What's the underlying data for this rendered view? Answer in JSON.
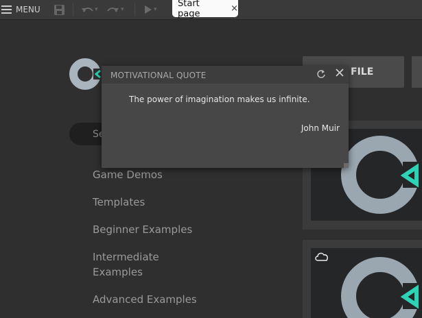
{
  "toolbar": {
    "menu_label": "MENU",
    "tab_label": "Start page",
    "tab_close": "×",
    "icons": [
      "menu-icon",
      "save-icon",
      "undo-icon",
      "redo-icon",
      "play-icon"
    ]
  },
  "search": {
    "placeholder": "Se"
  },
  "nav": {
    "items": [
      {
        "label": "Game Demos"
      },
      {
        "label": "Templates"
      },
      {
        "label": "Beginner Examples"
      },
      {
        "label": "Intermediate\nExamples"
      },
      {
        "label": "Advanced Examples"
      }
    ]
  },
  "file_button": {
    "label": "FILE"
  },
  "dialog": {
    "title": "MOTIVATIONAL QUOTE",
    "quote": "The power of imagination makes us infinite.",
    "author": "John Muir"
  },
  "colors": {
    "background": "#2f2f2f",
    "toolbar": "#3a3a3a",
    "accent_teal": "#2ed3b5",
    "logo_gray": "#9aa7b0",
    "dialog": "#474747"
  }
}
